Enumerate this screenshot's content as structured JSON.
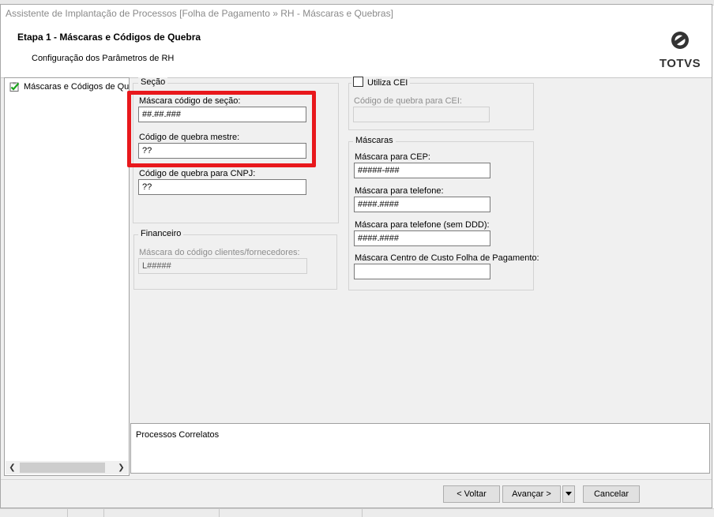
{
  "window": {
    "title": "Assistente de Implantação de Processos [Folha de Pagamento » RH - Máscaras e Quebras]"
  },
  "header": {
    "step_title": "Etapa 1 - Máscaras e Códigos de Quebra",
    "subtitle": "Configuração dos Parâmetros de RH",
    "logo": "TOTVS"
  },
  "nav": {
    "items": [
      {
        "label": "Máscaras e Códigos de Quebra",
        "icon": "checked-clipboard-icon",
        "status": "done"
      }
    ]
  },
  "secao": {
    "legend": "Seção",
    "mascara_secao_label": "Máscara código de seção:",
    "mascara_secao_value": "##.##.###",
    "quebra_mestre_label": "Código de quebra mestre:",
    "quebra_mestre_value": "??",
    "quebra_cnpj_label": "Código de quebra para CNPJ:",
    "quebra_cnpj_value": "??"
  },
  "financeiro": {
    "legend": "Financeiro",
    "mascara_label": "Máscara do código clientes/fornecedores:",
    "mascara_value": "L#####"
  },
  "cei": {
    "checkbox_label": "Utiliza CEI",
    "checked": false,
    "quebra_label": "Código de quebra para CEI:",
    "quebra_value": ""
  },
  "mascaras": {
    "legend": "Máscaras",
    "cep_label": "Máscara para CEP:",
    "cep_value": "#####-###",
    "telefone_label": "Máscara para telefone:",
    "telefone_value": "####.####",
    "telefone_sem_ddd_label": "Máscara para telefone (sem DDD):",
    "telefone_sem_ddd_value": "####.####",
    "centro_custo_label": "Máscara Centro de Custo Folha de Pagamento:",
    "centro_custo_value": ""
  },
  "related": {
    "title": "Processos Correlatos"
  },
  "footer": {
    "back_label": "< Voltar",
    "next_label": "Avançar >",
    "cancel_label": "Cancelar"
  },
  "colors": {
    "highlight": "#e8181c",
    "dialog_bg": "#f0f0f0"
  }
}
